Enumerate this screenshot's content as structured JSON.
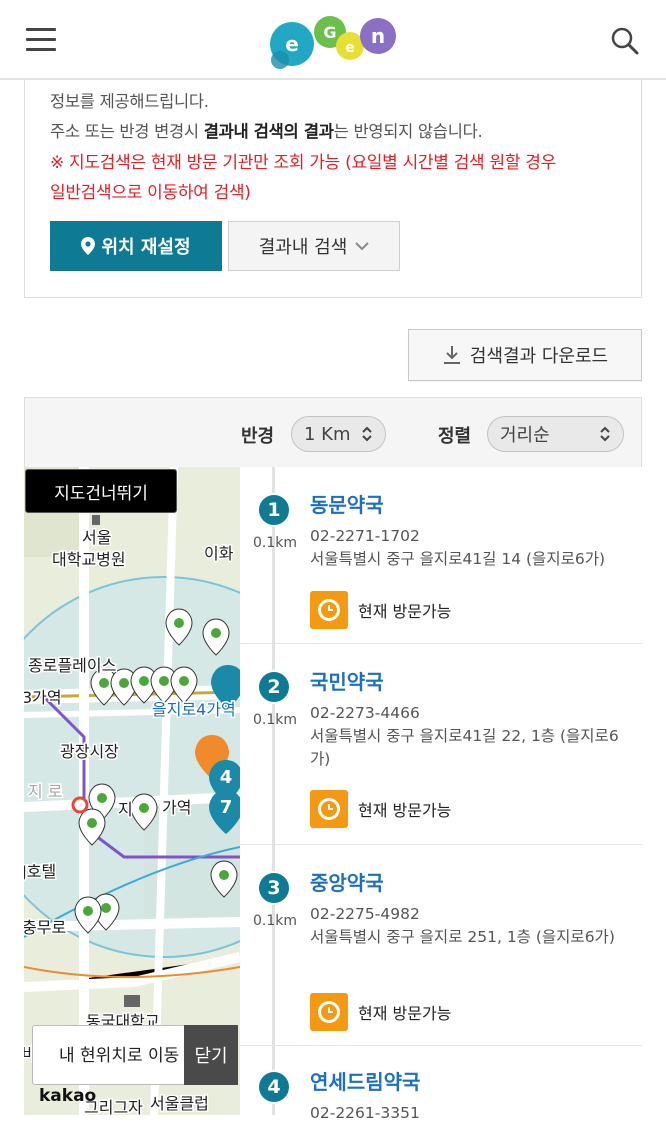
{
  "header": {
    "menu_icon": "hamburger-menu-icon",
    "logo_icon": "e-gen-logo",
    "search_icon": "search-icon",
    "brand_colors": [
      "#22a8c4",
      "#6bc04b",
      "#e8df35",
      "#8a6fc5"
    ]
  },
  "info": {
    "line1": "정보를 제공해드립니다.",
    "line2_pre": "주소 또는 반경 변경시 ",
    "line2_bold": "결과내 검색의 결과",
    "line2_post": "는 반영되지 않습니다.",
    "warn_line1": "※ 지도검색은 현재 방문 기관만 조회 가능 (요일별 시간별 검색 원할 경우",
    "warn_line2": "일반검색으로 이동하여 검색)",
    "reset_label": "위치 재설정",
    "refine_label": "결과내 검색",
    "accent_color": "#0f7a93",
    "warn_color": "#e41e26"
  },
  "download_label": "검색결과 다운로드",
  "filters": {
    "radius_label": "반경",
    "radius_value": "1 Km",
    "sort_label": "정렬",
    "sort_value": "거리순"
  },
  "map": {
    "skip_label": "지도건너뛰기",
    "locate_label": "내 현위치로 이동",
    "close_label": "닫기",
    "provider": "kakao",
    "labels": [
      {
        "text": "서울"
      },
      {
        "text": "대학교병원"
      },
      {
        "text": "이화"
      },
      {
        "text": "종로플레이스"
      },
      {
        "text": "3가역"
      },
      {
        "text": "을지로4가역"
      },
      {
        "text": "광장시장"
      },
      {
        "text": "지 로"
      },
      {
        "text": "지"
      },
      {
        "text": "가역"
      },
      {
        "text": "J호텔"
      },
      {
        "text": "충무로"
      },
      {
        "text": "동국대학교"
      },
      {
        "text": "바"
      },
      {
        "text": "서울클럽"
      },
      {
        "text": "그리그자"
      }
    ]
  },
  "results": [
    {
      "num": "1",
      "name": "동문약국",
      "dist": "0.1km",
      "phone": "02-2271-1702",
      "addr": "서울특별시 중구 을지로41길 14 (을지로6가)",
      "status": "현재 방문가능"
    },
    {
      "num": "2",
      "name": "국민약국",
      "dist": "0.1km",
      "phone": "02-2273-4466",
      "addr": "서울특별시 중구 을지로41길 22, 1층 (을지로6가)",
      "status": "현재 방문가능"
    },
    {
      "num": "3",
      "name": "중앙약국",
      "dist": "0.1km",
      "phone": "02-2275-4982",
      "addr": "서울특별시 중구 을지로 251, 1층 (을지로6가)",
      "status": "현재 방문가능"
    },
    {
      "num": "4",
      "name": "연세드림약국",
      "dist": "",
      "phone": "02-2261-3351",
      "addr": "",
      "status": ""
    }
  ]
}
